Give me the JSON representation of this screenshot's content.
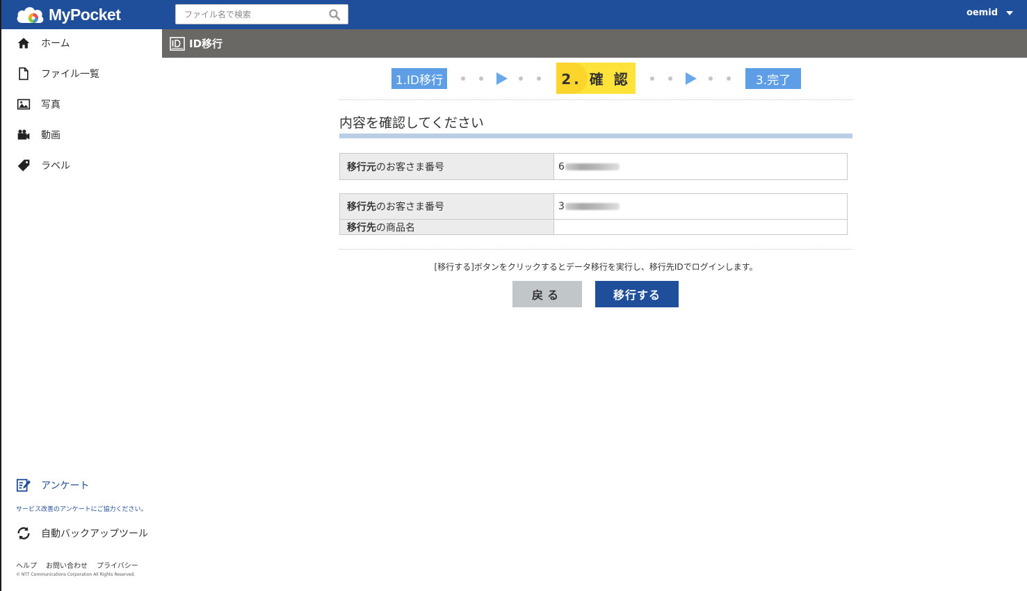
{
  "header": {
    "app_name": "MyPocket",
    "search_placeholder": "ファイル名で検索",
    "user_name": "oemid"
  },
  "sidebar": {
    "items": [
      {
        "label": "ホーム",
        "icon": "home-icon"
      },
      {
        "label": "ファイル一覧",
        "icon": "file-icon"
      },
      {
        "label": "写真",
        "icon": "photo-icon"
      },
      {
        "label": "動画",
        "icon": "video-camera-icon"
      },
      {
        "label": "ラベル",
        "icon": "tag-icon"
      }
    ],
    "survey": {
      "label": "アンケート",
      "note": "サービス改善のアンケートにご協力ください。",
      "icon": "survey-edit-icon"
    },
    "backup_tool": {
      "label": "自動バックアップツール",
      "icon": "sync-icon"
    },
    "footer_links": [
      "ヘルプ",
      "お問い合わせ",
      "プライバシー"
    ],
    "copyright": "© NTT Communications Corporation All Rights Reserved."
  },
  "page": {
    "title": "ID移行",
    "steps": {
      "step1": "1.ID移行",
      "step2": "2. 確 認",
      "step3": "3.完了",
      "current": 2
    },
    "section_title": "内容を確認してください",
    "source": {
      "label_bold": "移行元",
      "label_rest": "のお客さま番号",
      "value_prefix": "6"
    },
    "dest": {
      "number_label_bold": "移行先",
      "number_label_rest": "のお客さま番号",
      "number_prefix": "3",
      "product_label_bold": "移行先",
      "product_label_rest": "の商品名",
      "product_value": ""
    },
    "instruction": "[移行する]ボタンをクリックするとデータ移行を実行し、移行先IDでログインします。",
    "back_button": "戻る",
    "migrate_button": "移行する"
  },
  "colors": {
    "header": "#1f4e9a",
    "titlebar": "#6a6865",
    "step_active": "#ffe23a",
    "step_inactive": "#5e9ee6"
  }
}
